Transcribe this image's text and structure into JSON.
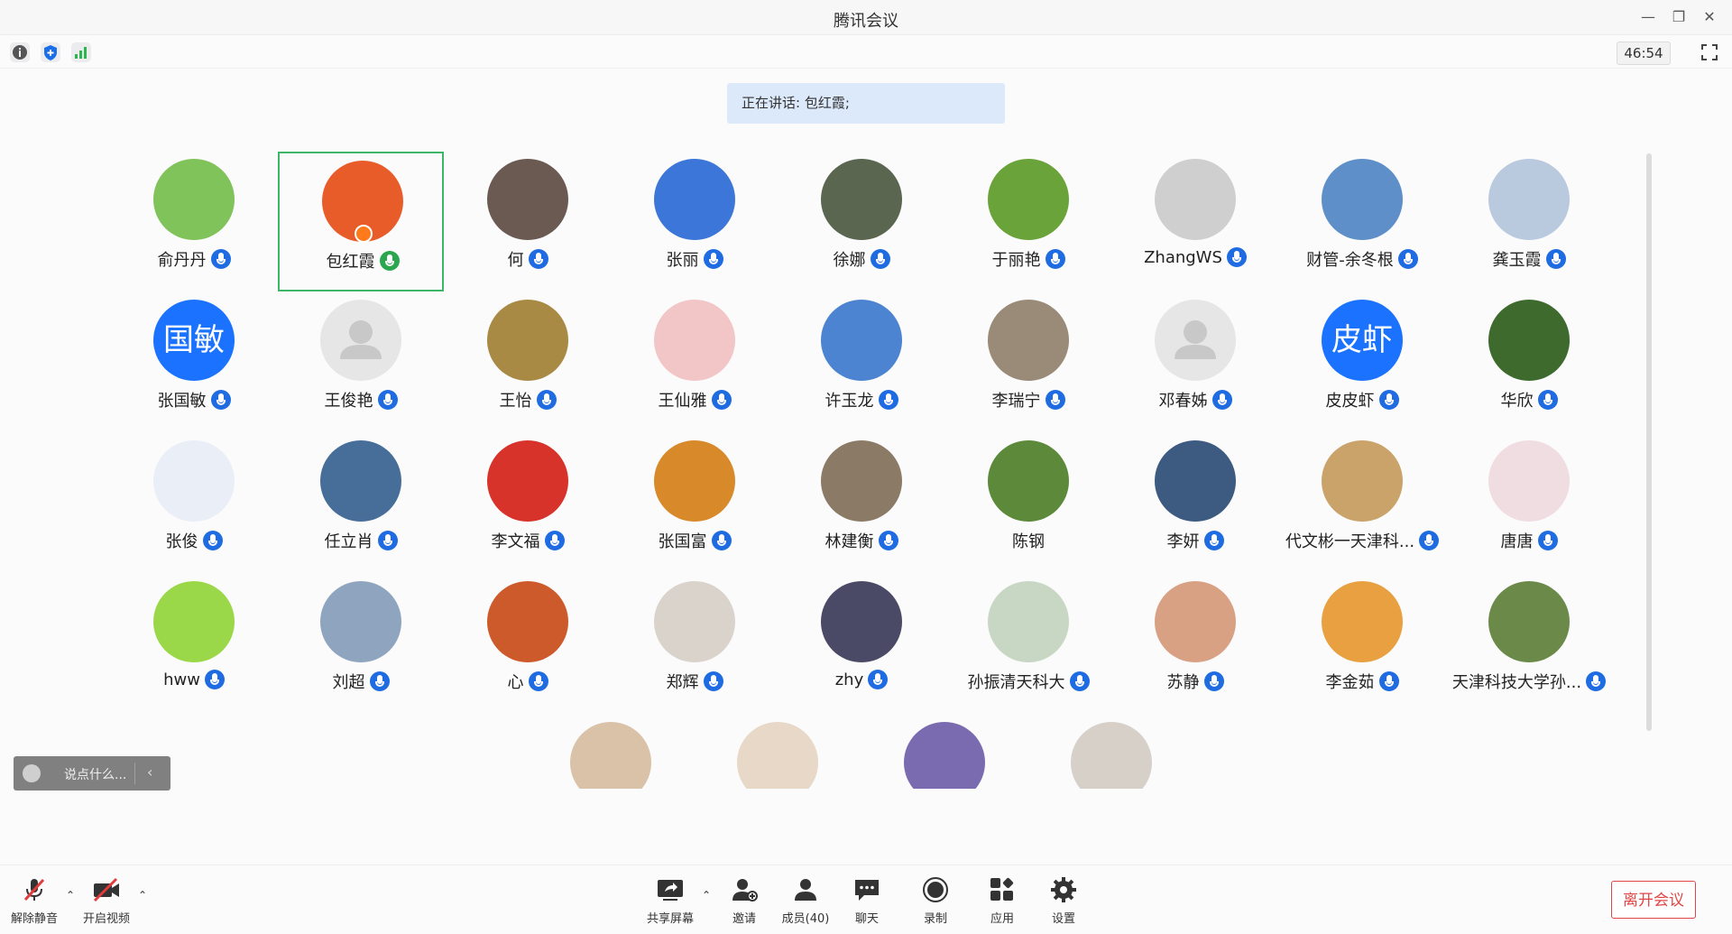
{
  "window": {
    "title": "腾讯会议",
    "timer": "46:54"
  },
  "speaking": "正在讲话: 包红霞;",
  "participants": [
    {
      "name": "俞丹丹",
      "mic": "blue",
      "bg": "#7fc35a"
    },
    {
      "name": "包红霞",
      "mic": "green",
      "bg": "#e85c2a",
      "active": true,
      "host": true
    },
    {
      "name": "何",
      "mic": "blue",
      "bg": "#6b5a52"
    },
    {
      "name": "张丽",
      "mic": "blue",
      "bg": "#3c76d8"
    },
    {
      "name": "徐娜",
      "mic": "blue",
      "bg": "#5a6650"
    },
    {
      "name": "于丽艳",
      "mic": "blue",
      "bg": "#6aa33a"
    },
    {
      "name": "ZhangWS",
      "mic": "blue",
      "bg": "#cfcfcf"
    },
    {
      "name": "财管-余冬根",
      "mic": "blue",
      "bg": "#5e8fc9"
    },
    {
      "name": "龚玉霞",
      "mic": "blue",
      "bg": "#b9c9de"
    },
    {
      "name": "张国敏",
      "mic": "blue",
      "bg": "#1a72ff",
      "text": "国敏"
    },
    {
      "name": "王俊艳",
      "mic": "blue",
      "bg": "#e6e6e6",
      "placeholder": true
    },
    {
      "name": "王怡",
      "mic": "blue",
      "bg": "#a88a45"
    },
    {
      "name": "王仙雅",
      "mic": "blue",
      "bg": "#f2c6c6"
    },
    {
      "name": "许玉龙",
      "mic": "blue",
      "bg": "#4d84d1"
    },
    {
      "name": "李瑞宁",
      "mic": "blue",
      "bg": "#9a8a78"
    },
    {
      "name": "邓春姊",
      "mic": "blue",
      "bg": "#e6e6e6",
      "placeholder": true
    },
    {
      "name": "皮皮虾",
      "mic": "blue",
      "bg": "#1a72ff",
      "text": "皮虾"
    },
    {
      "name": "华欣",
      "mic": "blue",
      "bg": "#3f6a2d"
    },
    {
      "name": "张俊",
      "mic": "blue",
      "bg": "#e9eef7"
    },
    {
      "name": "任立肖",
      "mic": "blue",
      "bg": "#466e99"
    },
    {
      "name": "李文福",
      "mic": "blue",
      "bg": "#d8332a"
    },
    {
      "name": "张国富",
      "mic": "blue",
      "bg": "#d8892a"
    },
    {
      "name": "林建衡",
      "mic": "blue",
      "bg": "#8a7a66"
    },
    {
      "name": "陈钢",
      "mic": "none",
      "bg": "#5c8a3a"
    },
    {
      "name": "李妍",
      "mic": "blue",
      "bg": "#3d5a80"
    },
    {
      "name": "代文彬一天津科...",
      "mic": "blue",
      "bg": "#c9a36a"
    },
    {
      "name": "唐唐",
      "mic": "blue",
      "bg": "#f0dde2"
    },
    {
      "name": "hww",
      "mic": "blue",
      "bg": "#9ad84a"
    },
    {
      "name": "刘超",
      "mic": "blue",
      "bg": "#8fa5bf"
    },
    {
      "name": "心",
      "mic": "blue",
      "bg": "#cc5a2a"
    },
    {
      "name": "郑辉",
      "mic": "blue",
      "bg": "#d9d3cb"
    },
    {
      "name": "zhy",
      "mic": "blue",
      "bg": "#4a4a66"
    },
    {
      "name": "孙振清天科大",
      "mic": "blue",
      "bg": "#c8d7c4"
    },
    {
      "name": "苏静",
      "mic": "blue",
      "bg": "#d9a183"
    },
    {
      "name": "李金茹",
      "mic": "blue",
      "bg": "#e8a040"
    },
    {
      "name": "天津科技大学孙...",
      "mic": "blue",
      "bg": "#6b8a4a"
    },
    {
      "name": "",
      "mic": "none",
      "bg": "#d9c2a8"
    },
    {
      "name": "",
      "mic": "none",
      "bg": "#e7d8c8"
    },
    {
      "name": "",
      "mic": "none",
      "bg": "#7a6ab0"
    },
    {
      "name": "",
      "mic": "none",
      "bg": "#d6d0c8"
    }
  ],
  "chat": {
    "placeholder": "说点什么..."
  },
  "controls": {
    "unmute": "解除静音",
    "video": "开启视频",
    "share": "共享屏幕",
    "invite": "邀请",
    "members": "成员(40)",
    "chat": "聊天",
    "record": "录制",
    "apps": "应用",
    "settings": "设置",
    "leave": "离开会议"
  }
}
